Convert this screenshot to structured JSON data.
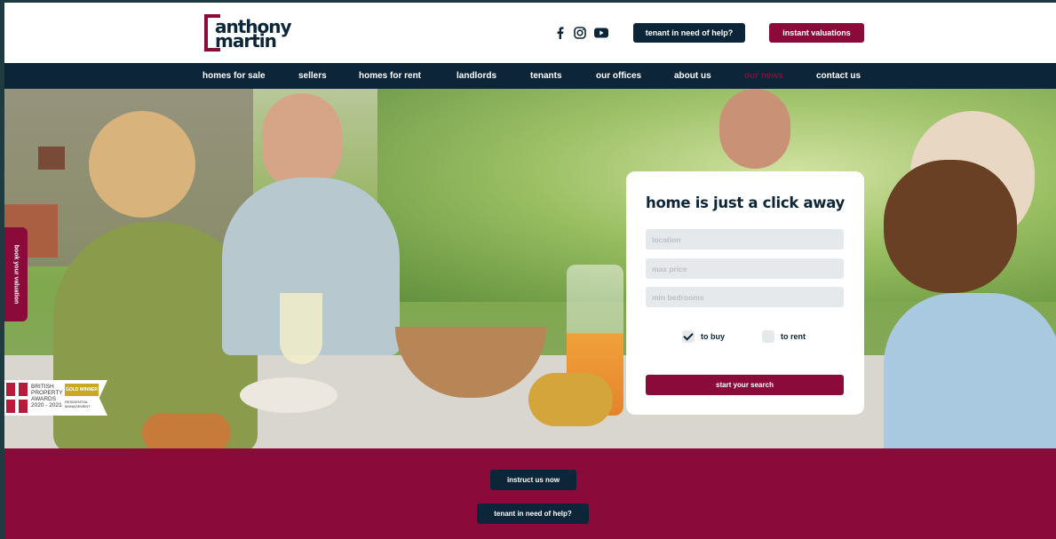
{
  "brand": {
    "logo_line1": "anthony",
    "logo_line2": "martin",
    "colors": {
      "navy": "#0c2538",
      "wine": "#8a0b3a"
    }
  },
  "header": {
    "social_icons": [
      "facebook-icon",
      "instagram-icon",
      "youtube-icon"
    ],
    "tenant_help_label": "tenant in need of help?",
    "valuations_label": "instant valuations"
  },
  "nav": {
    "items": [
      {
        "label": "homes for sale"
      },
      {
        "label": "sellers"
      },
      {
        "label": "homes for rent"
      },
      {
        "label": "landlords"
      },
      {
        "label": "tenants"
      },
      {
        "label": "our offices"
      },
      {
        "label": "about us"
      },
      {
        "label": "our news",
        "active": true
      },
      {
        "label": "contact us"
      }
    ]
  },
  "side_tab": {
    "label": "book your valuation"
  },
  "award": {
    "title": "BRITISH PROPERTY AWARDS",
    "years": "2020 - 2021",
    "badge": "GOLD WINNER",
    "sub": "RESIDENTIAL MANAGEMENT"
  },
  "search": {
    "title": "home is just a click away",
    "location_placeholder": "location",
    "max_price_placeholder": "max price",
    "min_bedrooms_placeholder": "min bedrooms",
    "to_buy_label": "to buy",
    "to_buy_checked": true,
    "to_rent_label": "to rent",
    "to_rent_checked": false,
    "submit_label": "start your search"
  },
  "band": {
    "instruct_label": "instruct us now",
    "tenant_help_label": "tenant in need of help?"
  }
}
